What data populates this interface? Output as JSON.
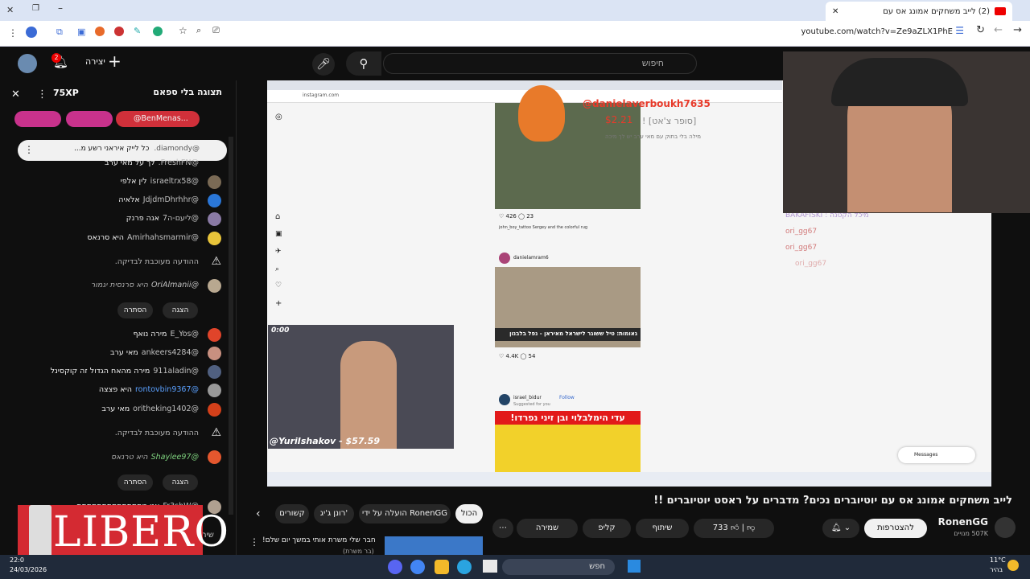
{
  "browser": {
    "tab_title": "(2) לייב משחקים אמונג אס עם",
    "url": "youtube.com/watch?v=Ze9aZLX1PhE"
  },
  "yt_header": {
    "create_label": "יצירה",
    "search_placeholder": "חיפוש",
    "notif_count": "2"
  },
  "chat": {
    "title": "תצוגה בלי ספאם",
    "xp": "75XP",
    "chip_user": "@BenMenas...",
    "pinned": {
      "user": "@diamondy.",
      "text": "כל לייק איראני רשע מ..."
    },
    "lines": [
      {
        "user": "@FreshFN.",
        "text": "לך על מאי ערב"
      },
      {
        "user": "@israeltrx58",
        "text": "לין אלפי"
      },
      {
        "user": "@JdjdmDhrhhr",
        "text": "אלאיה"
      },
      {
        "user": "@ליעם-ה7",
        "text": "אנה פרנק"
      },
      {
        "user": "@Amirhahsmarmir",
        "text": "היא סרנאס"
      },
      {
        "user": "",
        "text": "ההודעה מעוכבת לבדיקה."
      },
      {
        "user": "@OriAlmanii",
        "text": "היא סרנסית יגמור"
      },
      {
        "user": "@E_Yos",
        "text": "מירה נואף"
      },
      {
        "user": "@ankeers4284",
        "text": "מאי ערב"
      },
      {
        "user": "@911aladin",
        "text": "מירה מהאח הגדול זה קוקסינל"
      },
      {
        "user": "@rontovbin9367",
        "text": "היא פצצה"
      },
      {
        "user": "@oritheking1402",
        "text": "מאי ערב"
      },
      {
        "user": "",
        "text": "ההודעה מעוכבת לבדיקה."
      },
      {
        "user": "@Shaylee97",
        "text": "היא טרנאס"
      },
      {
        "user": "@Fr3shW",
        "text": "אני מתתתתתתתתתתתתת"
      }
    ],
    "show_label": "הצגה",
    "hide_label": "הסתרה",
    "send_label": "שיח"
  },
  "video": {
    "insta_url": "instagram.com",
    "donation_user": "@danielaverboukh7635",
    "donation_amount": "$2.21",
    "donation_text": "[סופר צ'אט] !",
    "donation_sub": "מילה בלי בתוק עם מאי ערב יש לך מיכה",
    "post1_user": "john_boy_tattoo",
    "post1_caption": "Sergey and the colorful rug",
    "post1_likes": "426",
    "post1_comments": "23",
    "post2_user": "danielamram6",
    "post2_likes": "4.4K",
    "post2_comments": "54",
    "post2_headline": "גאומות: טיל ששוגר לישראל מאיראן - נפל בלבנון",
    "post3_user": "israel_bidur",
    "post3_follow": "Follow",
    "post3_sub": "Suggested for you",
    "post3_headline": "עדי הימלבלוי ובן זיני נפרדו!",
    "pip_donation": "@YuriIshakov - $57.59",
    "pip_time": "0:00",
    "webcam_user": "BAKAFISKI",
    "webcam_user_text": "מיכל הקטנה",
    "webcam_user2": "ori_gg67",
    "messages_label": "Messages"
  },
  "below": {
    "tags": [
      "הכול",
      "הועלה על ידי RonenGG",
      "רונן ג'יג'",
      "קשורים"
    ],
    "title": "לייב משחקים אמונג אס עם יוטיוברים נכים? מדברים על ראסט יוטיוברים !!",
    "channel": "RonenGG",
    "subs": "507K מנויים",
    "join": "להצטרפות",
    "likes": "733",
    "share": "שיתוף",
    "clip": "קליפ",
    "save": "שמירה",
    "rec_title": "חבר שלי משרת אותי במשך יום שלם!",
    "rec_sub": "(בר משרת)"
  },
  "taskbar": {
    "search": "חפש",
    "time": "22:0",
    "date": "24/03/2026",
    "temp": "11°C",
    "weather": "בהיר",
    "overlay_brand": "LIBERO"
  }
}
